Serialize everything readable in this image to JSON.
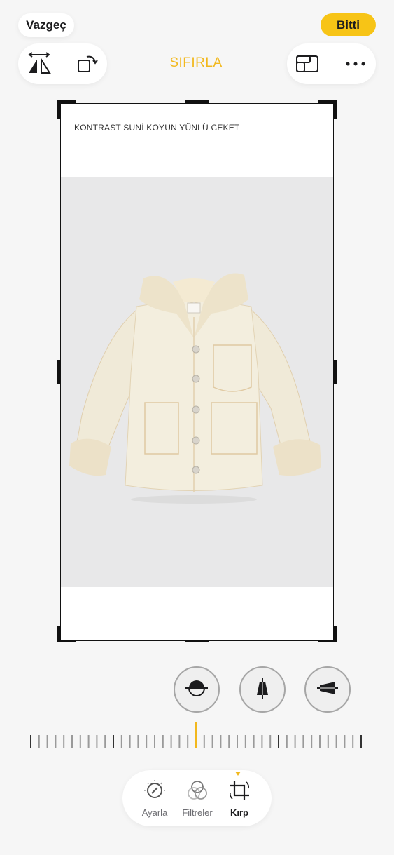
{
  "header": {
    "cancel_label": "Vazgeç",
    "done_label": "Bitti",
    "reset_label": "SIFIRLA"
  },
  "toolbar_left": {
    "icons": [
      "flip-horizontal-icon",
      "rotate-icon"
    ]
  },
  "toolbar_right": {
    "icons": [
      "aspect-ratio-icon",
      "more-icon"
    ]
  },
  "image": {
    "product_title": "KONTRAST SUNİ KOYUN YÜNLÜ CEKET"
  },
  "adjust_controls": {
    "icons": [
      "straighten-icon",
      "vertical-perspective-icon",
      "horizontal-perspective-icon"
    ]
  },
  "tabs": [
    {
      "label": "Ayarla",
      "icon": "adjust-dial-icon",
      "active": false
    },
    {
      "label": "Filtreler",
      "icon": "filters-icon",
      "active": false
    },
    {
      "label": "Kırp",
      "icon": "crop-rotate-icon",
      "active": true
    }
  ],
  "colors": {
    "accent": "#f2b81d",
    "done_button": "#f7c416",
    "background": "#f6f6f6"
  }
}
